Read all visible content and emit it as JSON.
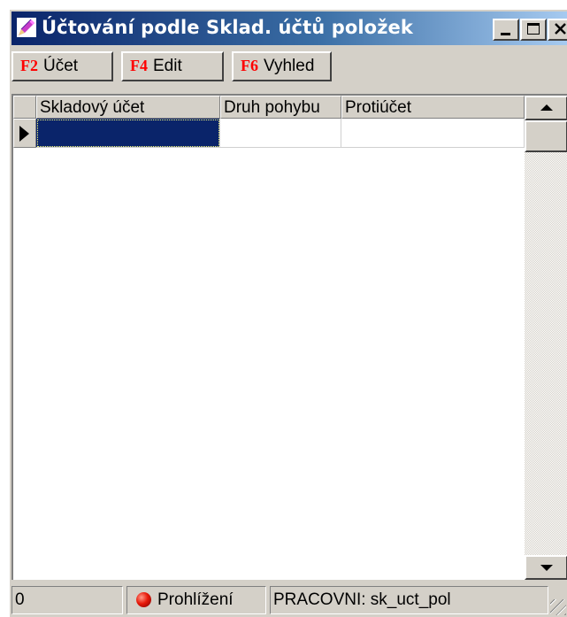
{
  "window": {
    "title": "Účtování podle Sklad. účtů položek",
    "icon": "pencil-app-icon",
    "caption_buttons": [
      "minimize",
      "maximize",
      "close"
    ]
  },
  "toolbar": {
    "buttons": [
      {
        "key": "F2",
        "label": "Účet"
      },
      {
        "key": "F4",
        "label": "Edit"
      },
      {
        "key": "F6",
        "label": "Vyhled"
      }
    ]
  },
  "grid": {
    "columns": [
      "Skladový účet",
      "Druh pohybu",
      "Protiúčet"
    ],
    "rows": [
      {
        "skladovy_ucet": "",
        "druh_pohybu": "",
        "protiucet": "",
        "selected": true
      }
    ]
  },
  "status": {
    "record_count": "0",
    "mode": "Prohlížení",
    "context": "PRACOVNI: sk_uct_pol"
  },
  "colors": {
    "title_gradient_start": "#0a246a",
    "title_gradient_end": "#a6caf0",
    "face": "#d4d0c8",
    "selection": "#0a246a",
    "hotkey": "#ff0000"
  }
}
